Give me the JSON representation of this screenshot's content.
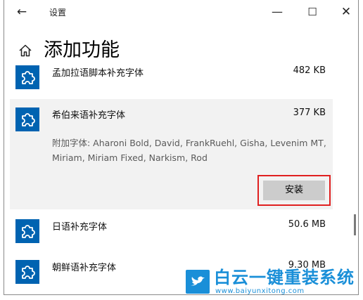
{
  "window": {
    "title": "设置",
    "back_icon": "←",
    "minimize_icon": "—",
    "maximize_icon": "☐",
    "close_icon": "✕"
  },
  "page": {
    "title": "添加功能"
  },
  "features": [
    {
      "name": "孟加拉语脚本补充字体",
      "size": "482 KB"
    },
    {
      "name": "希伯来语补充字体",
      "size": "377 KB",
      "description": "附加字体: Aharoni Bold, David, FrankRuehl, Gisha, Levenim MT, Miriam, Miriam Fixed, Narkism, Rod",
      "install_label": "安装"
    },
    {
      "name": "日语补充字体",
      "size": "50.6 MB"
    },
    {
      "name": "朝鲜语补充字体",
      "size": "9.30 MB"
    }
  ],
  "watermark": {
    "brand": "白云一键重装系统",
    "url": "www.baiyunxitong.com",
    "accent_color": "#1a8fd8"
  },
  "colors": {
    "icon_blue": "#0063b1",
    "expanded_bg": "#f2f2f2",
    "button_bg": "#cccccc",
    "highlight_red": "#e02020"
  }
}
